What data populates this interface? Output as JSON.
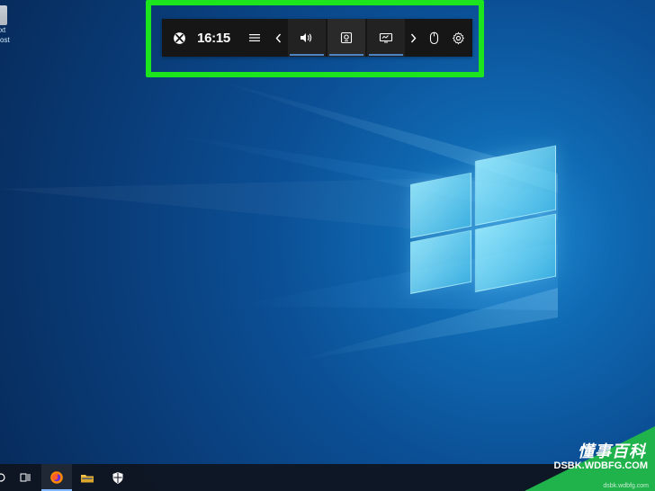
{
  "desktop": {
    "icon": {
      "label_line1": "xt",
      "label_line2": "ost"
    }
  },
  "gamebar": {
    "time": "16:15",
    "icons": {
      "xbox": "xbox-icon",
      "menu": "menu-icon",
      "prev": "chevron-left-icon",
      "audio": "speaker-icon",
      "capture": "capture-icon",
      "performance": "performance-icon",
      "next": "chevron-right-icon",
      "mouse": "mouse-icon",
      "settings": "gear-icon"
    }
  },
  "taskbar": {
    "items": [
      {
        "icon": "search-icon"
      },
      {
        "icon": "task-view-icon"
      },
      {
        "icon": "firefox-icon"
      },
      {
        "icon": "folder-icon"
      },
      {
        "icon": "shield-icon"
      }
    ]
  },
  "watermark": {
    "title": "懂事百科",
    "subtitle": "DSBK.WDBFG.COM",
    "tiny": "dsbk.wdbfg.com"
  },
  "colors": {
    "highlight": "#1de51d",
    "gamebar_bg": "#161616",
    "watermark_bg": "#20b24b"
  }
}
